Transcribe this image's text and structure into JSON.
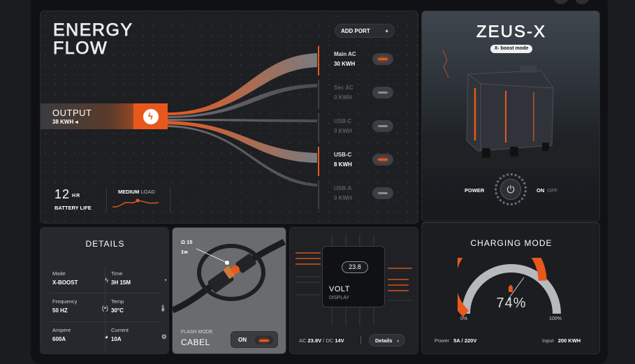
{
  "energy_flow": {
    "title_line1": "ENERGY",
    "title_line2": "FLOW",
    "add_port": "ADD PORT",
    "add_icon": "plus-icon",
    "output_label": "OUTPUT",
    "output_value": "38 KWH",
    "bolt_icon": "bolt-icon",
    "ports": [
      {
        "name": "Main AC",
        "value": "30 KWH",
        "active": true
      },
      {
        "name": "Sec AC",
        "value": "0 KWH",
        "active": false
      },
      {
        "name": "USB-C",
        "value": "0 KWH",
        "active": false
      },
      {
        "name": "USB-C",
        "value": "8 KWH",
        "active": true
      },
      {
        "name": "USB-A",
        "value": "0 KWH",
        "active": false
      }
    ],
    "battery_hours": "12",
    "battery_unit": "HR",
    "battery_label": "BATTERY LIFE",
    "load_strong": "MEDIUM",
    "load_rest": " LOAD"
  },
  "zeus": {
    "title": "ZEUS-X",
    "badge": "X- boost mode",
    "power_label": "POWER",
    "on_label": "ON",
    "off_label": "OFF",
    "power_icon": "power-icon"
  },
  "charging": {
    "title": "CHARGING MODE",
    "percent_text": "74%",
    "percent_value": 74,
    "min_label": "0%",
    "max_label": "100%",
    "power_label": "Power",
    "power_value": "5A / 220V",
    "input_label": "Input",
    "input_value": "200 KWH",
    "accent": "#e8581b"
  },
  "details": {
    "title": "DETAILS",
    "items": [
      {
        "label": "Mode",
        "value": "X-BOOST",
        "icon": "bolt-icon"
      },
      {
        "label": "Time",
        "value": "3H 15M",
        "icon": "clock-icon"
      },
      {
        "label": "Frequency",
        "value": "50 HZ",
        "icon": "signal-icon"
      },
      {
        "label": "Temp",
        "value": "30°C",
        "icon": "thermometer-icon"
      },
      {
        "label": "Ampere",
        "value": "600A",
        "icon": "gauge-icon"
      },
      {
        "label": "Current",
        "value": "10A",
        "icon": "gear-icon"
      }
    ]
  },
  "cable": {
    "spec1": "Ω 15",
    "spec2": "1w",
    "flash_mode": "FLASH MODE",
    "name": "CABEL",
    "toggle_label": "ON"
  },
  "volt": {
    "reading": "23.8",
    "name": "VOLT",
    "sub": "DISPLAY",
    "ac_label": "AC",
    "ac_value": "23.8V",
    "dc_label": "DC",
    "dc_value": "14V",
    "details_button": "Details"
  }
}
